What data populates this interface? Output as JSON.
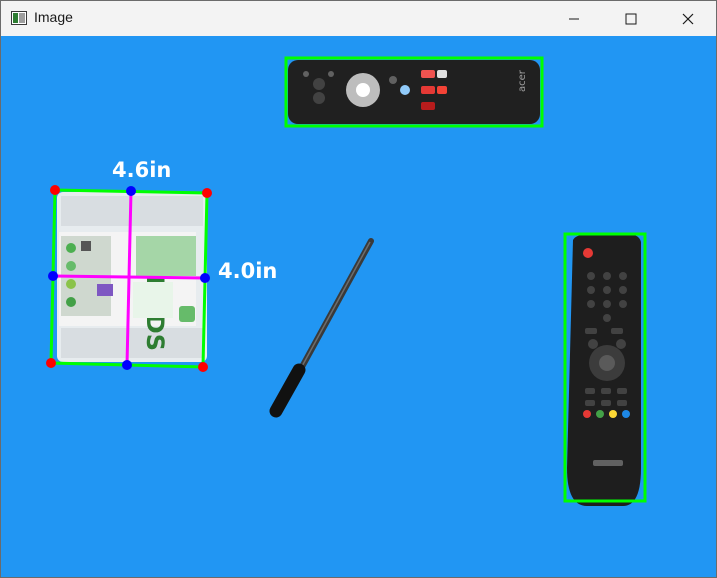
{
  "window": {
    "title": "Image",
    "icons": {
      "app": "image-viewer-app-icon",
      "minimize": "minimize-icon",
      "maximize": "maximize-icon",
      "close": "close-icon"
    }
  },
  "measurements": {
    "width_label": "4.6in",
    "height_label": "4.0in"
  },
  "colors": {
    "background": "#2196f3",
    "bounding_box": "#00ff00",
    "midline": "#ff00ff",
    "corner_point": "#ff0000",
    "midpoint": "#0000ff",
    "label_text": "#ffffff"
  },
  "objects": [
    "earbuds-box",
    "tv-remote-horizontal",
    "stylus-pen",
    "set-top-box-remote"
  ]
}
